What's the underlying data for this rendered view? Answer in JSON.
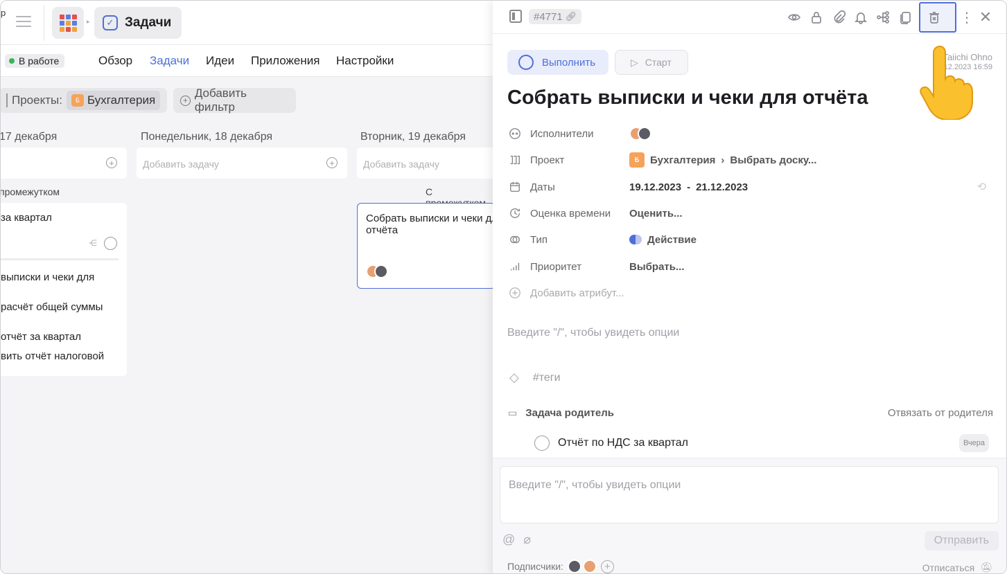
{
  "left": {
    "edge_char": "р",
    "breadcrumb_title": "Задачи",
    "status_label": "В работе",
    "nav": [
      "Обзор",
      "Задачи",
      "Идеи",
      "Приложения",
      "Настройки"
    ],
    "filter_projects_label": "Проекты:",
    "filter_project_badge": "Б",
    "filter_project_name": "Бухгалтерия",
    "add_filter_label": "Добавить фильтр",
    "columns": [
      {
        "head": "17 декабря",
        "add_placeholder": ""
      },
      {
        "head": "Понедельник, 18 декабря",
        "add_placeholder": "Добавить задачу"
      },
      {
        "head": "Вторник, 19 декабря",
        "add_placeholder": "Добавить задачу"
      }
    ],
    "col0_sublabel": "промежутком",
    "col2_sublabel": "С промежутком",
    "col0_card_title": "за квартал",
    "col0_subtasks": [
      "выписки и чеки для",
      "расчёт общей суммы",
      "отчёт за квартал",
      "вить отчёт налоговой"
    ],
    "col2_card_title_line1": "Собрать выписки и чеки для",
    "col2_card_title_line2": "отчёта"
  },
  "detail": {
    "task_id": "#4771",
    "complete_label": "Выполнить",
    "start_label": "Старт",
    "author_name": "Taiichi Ohno",
    "author_date": "19.12.2023 16:59",
    "title": "Собрать выписки и чеки для отчёта",
    "attrs": {
      "assignees_label": "Исполнители",
      "project_label": "Проект",
      "project_badge": "Б",
      "project_value": "Бухгалтерия",
      "board_value": "Выбрать доску...",
      "dates_label": "Даты",
      "date_start": "19.12.2023",
      "date_sep": "-",
      "date_end": "21.12.2023",
      "estimate_label": "Оценка времени",
      "estimate_value": "Оценить...",
      "type_label": "Тип",
      "type_value": "Действие",
      "priority_label": "Приоритет",
      "priority_value": "Выбрать...",
      "add_attr_label": "Добавить атрибут..."
    },
    "editor_placeholder": "Введите \"/\", чтобы увидеть опции",
    "tags_placeholder": "#теги",
    "parent_label": "Задача родитель",
    "unlink_parent_label": "Отвязать от родителя",
    "parent_task": "Отчёт по НДС за квартал",
    "parent_badge": "Вчера",
    "comment_placeholder": "Введите \"/\", чтобы увидеть опции",
    "send_label": "Отправить",
    "subscribers_label": "Подписчики:",
    "unsubscribe_label": "Отписаться"
  },
  "colors": {
    "accent": "#4d6fd8",
    "status_green": "#3bb45a",
    "project_orange": "#f5a35a"
  }
}
